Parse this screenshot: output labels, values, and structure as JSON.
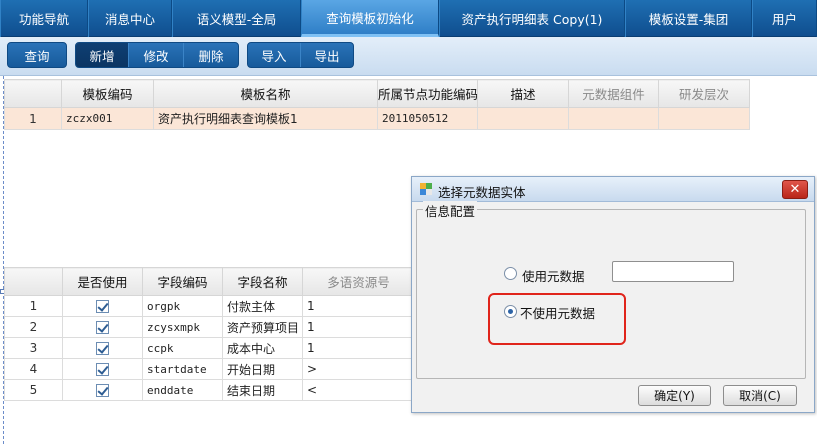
{
  "nav": {
    "tabs": [
      {
        "label": "功能导航"
      },
      {
        "label": "消息中心"
      },
      {
        "label": "语义模型-全局"
      },
      {
        "label": "查询模板初始化"
      },
      {
        "label": "资产执行明细表 Copy(1)"
      },
      {
        "label": "模板设置-集团"
      },
      {
        "label": "用户"
      }
    ],
    "active_tab": "查询模板初始化"
  },
  "toolbar": {
    "query": "查询",
    "add": "新增",
    "modify": "修改",
    "delete": "删除",
    "import": "导入",
    "export": "导出"
  },
  "template_grid": {
    "columns": [
      "模板编码",
      "模板名称",
      "所属节点功能编码",
      "描述",
      "元数据组件",
      "研发层次"
    ],
    "rows": [
      {
        "index": "1",
        "code": "zczx001",
        "name": "资产执行明细表查询模板1",
        "node_code": "2011050512",
        "desc": "",
        "meta": "",
        "level": ""
      }
    ]
  },
  "field_grid": {
    "columns": [
      "是否使用",
      "字段编码",
      "字段名称",
      "多语资源号"
    ],
    "rows": [
      {
        "index": "1",
        "used": true,
        "code": "orgpk",
        "name": "付款主体",
        "res": "1"
      },
      {
        "index": "2",
        "used": true,
        "code": "zcysxmpk",
        "name": "资产预算项目",
        "res": "1"
      },
      {
        "index": "3",
        "used": true,
        "code": "ccpk",
        "name": "成本中心",
        "res": "1"
      },
      {
        "index": "4",
        "used": true,
        "code": "startdate",
        "name": "开始日期",
        "res": ">"
      },
      {
        "index": "5",
        "used": true,
        "code": "enddate",
        "name": "结束日期",
        "res": "<"
      }
    ]
  },
  "dialog": {
    "title": "选择元数据实体",
    "group_label": "信息配置",
    "option_use": "使用元数据",
    "option_not_use": "不使用元数据",
    "selected": "不使用元数据",
    "metadata_value": "",
    "ok": "确定(Y)",
    "cancel": "取消(C)"
  },
  "colors": {
    "nav_bg": "#1f6fb3",
    "selected_row": "#fbe6d7",
    "highlight_box": "#e0241b"
  }
}
